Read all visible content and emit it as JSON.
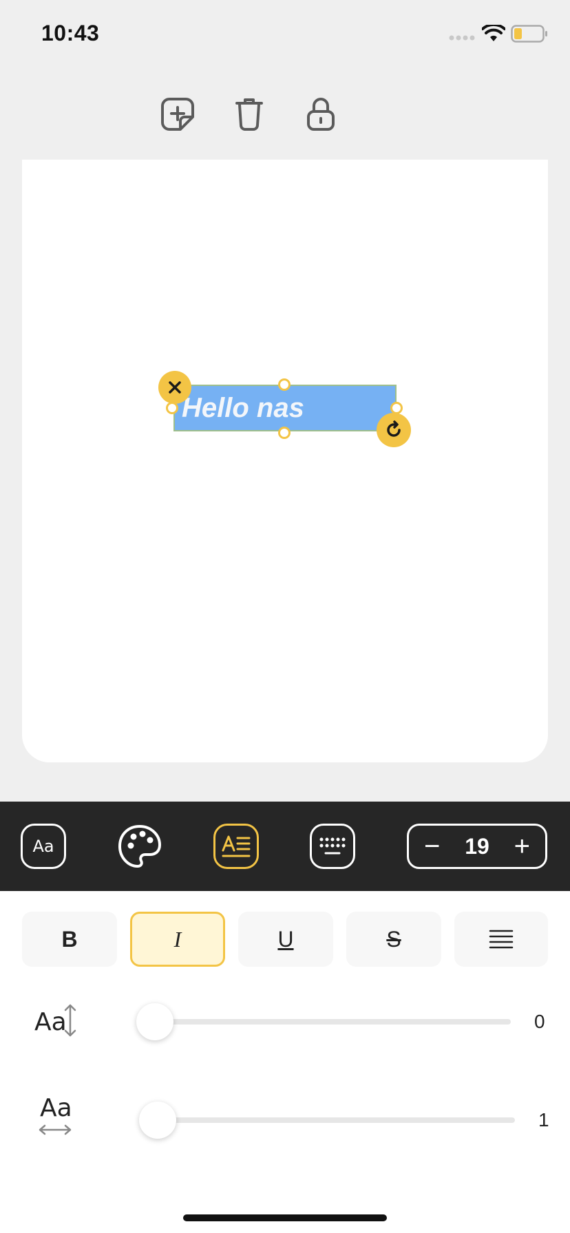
{
  "status_bar": {
    "time": "10:43"
  },
  "canvas": {
    "text_element": {
      "text": "Hello nas",
      "background_color": "#76b1f3",
      "handle_color": "#f3c445"
    }
  },
  "format_bar": {
    "font_size": "19",
    "minus": "−",
    "plus": "+",
    "font_button_label": "Aa",
    "active_tab": "text-style"
  },
  "style_buttons": {
    "bold": "B",
    "italic": "I",
    "underline": "U",
    "strikethrough": "S",
    "active": "italic"
  },
  "sliders": {
    "line_spacing": {
      "value": "0",
      "label": "Aa"
    },
    "letter_spacing": {
      "value": "1",
      "label": "Aa"
    }
  },
  "colors": {
    "accent": "#f3c445",
    "toolbar_bg": "#262626",
    "app_bg": "#efefef"
  }
}
